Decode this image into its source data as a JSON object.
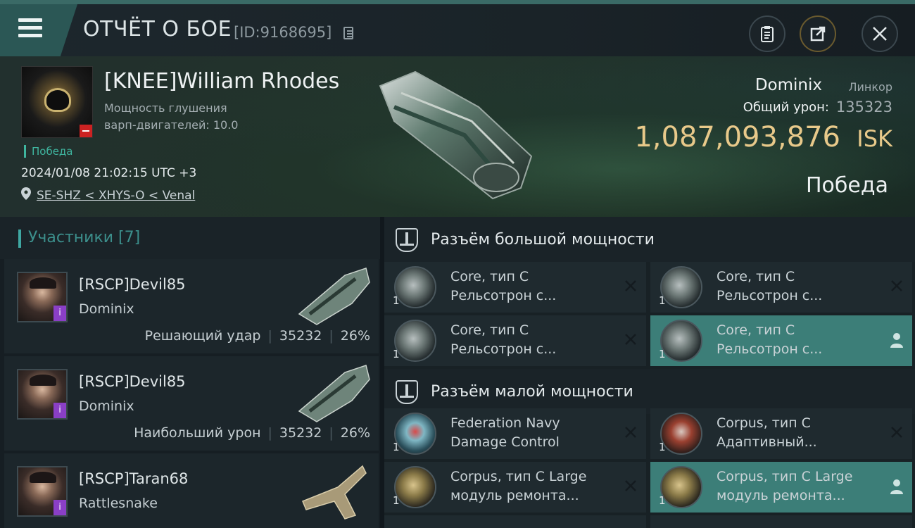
{
  "topbar": {
    "title": "ОТЧЁТ О БОЕ",
    "report_id": "[ID:9168695]",
    "icons": [
      "menu-icon",
      "copy-icon",
      "clipboard-icon",
      "share-icon",
      "close-icon"
    ]
  },
  "victim": {
    "name": "[KNEE]William Rhodes",
    "stat_line1": "Мощность глушения",
    "stat_line2": "варп-двигателей: 10.0",
    "tag": "Победа",
    "datetime": "2024/01/08 21:02:15 UTC +3",
    "location": "SE-SHZ < XHYS-O < Venal",
    "ship_name": "Dominix",
    "ship_class": "Линкор",
    "total_damage_label": "Общий урон:",
    "total_damage_value": "135323",
    "isk_value": "1,087,093,876",
    "isk_unit": "ISK",
    "result": "Победа"
  },
  "participants": {
    "title": "Участники [7]",
    "items": [
      {
        "name": "[RSCP]Devil85",
        "ship": "Dominix",
        "role": "Решающий удар",
        "damage": "35232",
        "percent": "26%"
      },
      {
        "name": "[RSCP]Devil85",
        "ship": "Dominix",
        "role": "Наибольший урон",
        "damage": "35232",
        "percent": "26%"
      },
      {
        "name": "[RSCP]Taran68",
        "ship": "Rattlesnake"
      }
    ]
  },
  "fittings": {
    "high_title": "Разъём большой мощности",
    "low_title": "Разъём малой мощности",
    "high": [
      {
        "qty": "1",
        "line1": "Core, тип C",
        "line2": "Рельсотрон с..."
      },
      {
        "qty": "1",
        "line1": "Core, тип C",
        "line2": "Рельсотрон с..."
      },
      {
        "qty": "1",
        "line1": "Core, тип C",
        "line2": "Рельсотрон с..."
      },
      {
        "qty": "1",
        "line1": "Core, тип C",
        "line2": "Рельсотрон с..."
      }
    ],
    "low": [
      {
        "qty": "1",
        "line1": "Federation Navy",
        "line2": "Damage Control"
      },
      {
        "qty": "1",
        "line1": "Corpus, тип C",
        "line2": "Адаптивный..."
      },
      {
        "qty": "1",
        "line1": "Corpus, тип C Large",
        "line2": "модуль ремонта..."
      },
      {
        "qty": "1",
        "line1": "Corpus, тип C Large",
        "line2": "модуль ремонта..."
      }
    ]
  },
  "colors": {
    "accent": "#3fa7a2",
    "isk": "#e8c98a",
    "active_slot": "#3c7e78",
    "drop_badge": "#8a3fc6"
  }
}
